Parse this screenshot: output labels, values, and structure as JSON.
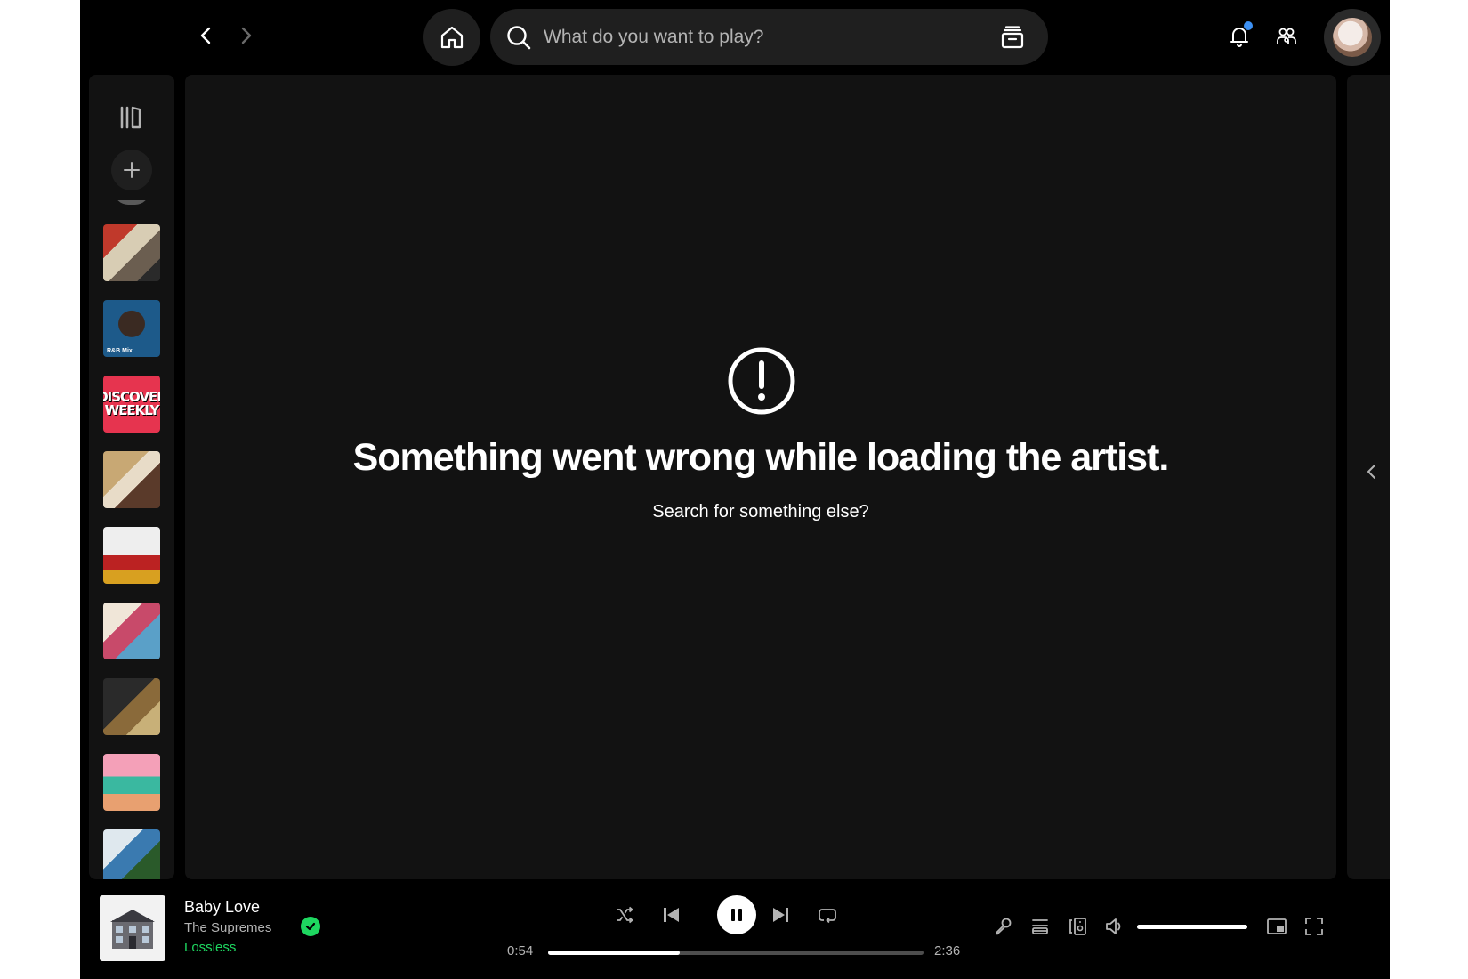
{
  "search": {
    "placeholder": "What do you want to play?"
  },
  "header": {
    "notification_dot": true
  },
  "icons": {
    "back": "chevron-left-icon",
    "forward": "chevron-right-icon",
    "home": "home-icon",
    "search": "search-icon",
    "browse": "browse-icon",
    "notifications": "bell-icon",
    "friends": "friends-icon",
    "library_toggle": "library-icon",
    "create": "plus-icon"
  },
  "library": {
    "items": [
      {
        "cover_text": ""
      },
      {
        "cover_text": "R&B Mix"
      },
      {
        "cover_text_1": "DISCOVER",
        "cover_text_2": "WEEKLY"
      },
      {
        "cover_text": ""
      },
      {
        "cover_text": ""
      },
      {
        "cover_text": ""
      },
      {
        "cover_text": ""
      },
      {
        "cover_text": ""
      },
      {
        "cover_text": ""
      }
    ]
  },
  "main": {
    "error_title": "Something went wrong while loading the artist.",
    "error_subtitle": "Search for something else?"
  },
  "player": {
    "track_title": "Baby Love",
    "artist": "The Supremes",
    "quality": "Lossless",
    "current_time": "0:54",
    "total_time": "2:36",
    "progress_fraction": 0.35,
    "volume_fraction": 1.0,
    "is_playing": true,
    "saved": true
  },
  "colors": {
    "background": "#000000",
    "panel": "#121212",
    "accent_green": "#1ed760",
    "notification_blue": "#3d91f4",
    "muted_text": "#b3b3b3"
  }
}
